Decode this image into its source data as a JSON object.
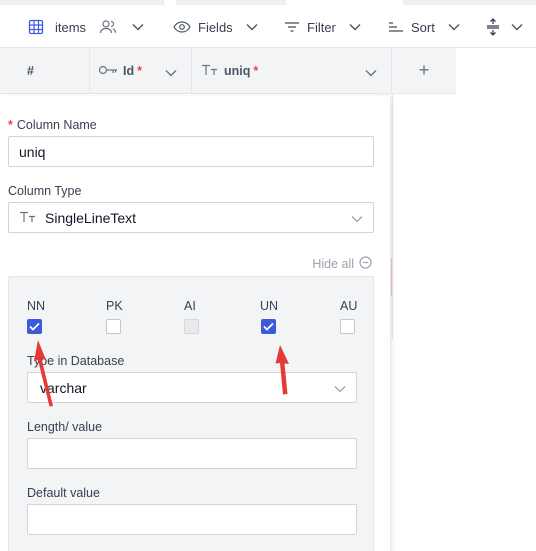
{
  "toolbar": {
    "table_name": "items",
    "fields_label": "Fields",
    "filter_label": "Filter",
    "sort_label": "Sort"
  },
  "grid": {
    "row_number_header": "#",
    "columns": [
      {
        "name": "Id",
        "required_marker": "*"
      },
      {
        "name": "uniq",
        "required_marker": "*"
      }
    ],
    "add_column": "+"
  },
  "column_editor": {
    "required_marker": "*",
    "name_label": "Column Name",
    "name_value": "uniq",
    "type_label": "Column Type",
    "type_value": "SingleLineText",
    "type_icon_text": "TT",
    "hide_all_label": "Hide all",
    "flags": [
      {
        "label": "NN",
        "checked": true,
        "disabled": false
      },
      {
        "label": "PK",
        "checked": false,
        "disabled": false
      },
      {
        "label": "AI",
        "checked": false,
        "disabled": true
      },
      {
        "label": "UN",
        "checked": true,
        "disabled": false
      },
      {
        "label": "AU",
        "checked": false,
        "disabled": false
      }
    ],
    "db_type_label": "Type in Database",
    "db_type_value": "varchar",
    "length_label": "Length/ value",
    "length_value": "",
    "default_label": "Default value",
    "default_value": ""
  },
  "colors": {
    "accent": "#3b5bdb",
    "annotation_arrow": "#e53935",
    "required": "#ef4444"
  }
}
